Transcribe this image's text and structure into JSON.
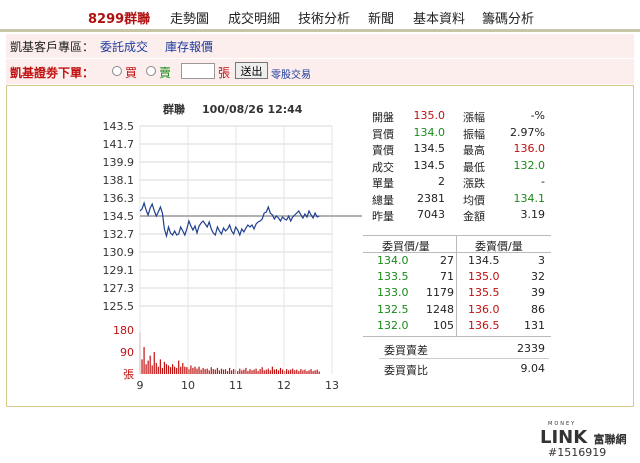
{
  "nav": {
    "items": [
      "8299群聯",
      "走勢圖",
      "成交明細",
      "技術分析",
      "新聞",
      "基本資料",
      "籌碼分析"
    ]
  },
  "broker": {
    "label": "凱基客戶專區：",
    "link1": "委託成交",
    "link2": "庫存報價"
  },
  "order": {
    "title": "凱基證劵下單：",
    "buy": "買",
    "sell": "賣",
    "qty_value": "",
    "unit": "張",
    "send": "送出",
    "oddlot": "零股交易"
  },
  "chart_data": {
    "type": "line",
    "title": "群聯",
    "datetime": "100/08/26 12:44",
    "reference_price": 134.5,
    "y_ticks": [
      "143.5",
      "141.7",
      "139.9",
      "138.1",
      "136.3",
      "134.5",
      "132.7",
      "130.9",
      "129.1",
      "127.3",
      "125.5"
    ],
    "ylim": [
      125.5,
      143.5
    ],
    "x_ticks": [
      "9",
      "10",
      "11",
      "12",
      "13"
    ],
    "volume_ticks": [
      "180",
      "90",
      "張"
    ],
    "series": [
      {
        "values": [
          135.0,
          135.2,
          135.8,
          135.1,
          134.6,
          135.3,
          135.7,
          135.0,
          134.5,
          134.9,
          135.4,
          134.8,
          133.2,
          132.5,
          133.4,
          132.8,
          132.6,
          133.0,
          132.6,
          132.7,
          133.4,
          133.0,
          132.6,
          133.2,
          134.0,
          133.5,
          133.1,
          133.5,
          132.8,
          133.5,
          133.8,
          134.0,
          133.7,
          133.4,
          133.9,
          133.2,
          132.8,
          132.6,
          133.4,
          133.0,
          132.7,
          133.3,
          133.0,
          133.2,
          133.6,
          133.0,
          132.7,
          133.4,
          133.1,
          132.6,
          133.2,
          132.9,
          133.3,
          133.6,
          133.4,
          133.6,
          133.2,
          133.7,
          133.9,
          134.0,
          134.2,
          134.8,
          134.9,
          135.4,
          134.8,
          134.6,
          134.2,
          134.5,
          134.3,
          134.0,
          134.4,
          134.2,
          134.1,
          134.5,
          134.0,
          134.4,
          134.6,
          134.8,
          135.0,
          134.6,
          134.3,
          134.7,
          134.4,
          135.0,
          134.6,
          134.3,
          134.8,
          134.4,
          134.5
        ]
      }
    ],
    "volume": [
      170,
      60,
      110,
      40,
      55,
      75,
      35,
      90,
      45,
      30,
      60,
      25,
      50,
      40,
      35,
      28,
      40,
      30,
      25,
      55,
      30,
      45,
      30,
      28,
      20,
      35,
      25,
      30,
      22,
      30,
      18,
      25,
      20,
      22,
      15,
      28,
      20,
      18,
      25,
      15,
      22,
      18,
      20,
      12,
      25,
      15,
      20,
      18,
      12,
      22,
      15,
      18,
      25,
      12,
      20,
      15,
      18,
      22,
      12,
      20,
      28,
      15,
      18,
      22,
      15,
      30,
      18,
      20,
      15,
      25,
      18,
      12,
      20,
      15,
      18,
      22,
      15,
      18,
      12,
      20,
      15,
      18,
      12,
      15,
      20,
      12,
      15,
      18,
      10
    ],
    "volume_max": 180
  },
  "quote": {
    "rows": [
      {
        "l1": "開盤",
        "v1": "135.0",
        "c1": "rd",
        "l2": "漲幅",
        "v2": "-%",
        "c2": "bk"
      },
      {
        "l1": "買價",
        "v1": "134.0",
        "c1": "gr",
        "l2": "振幅",
        "v2": "2.97%",
        "c2": "bk"
      },
      {
        "l1": "賣價",
        "v1": "134.5",
        "c1": "bk",
        "l2": "最高",
        "v2": "136.0",
        "c2": "rd"
      },
      {
        "l1": "成交",
        "v1": "134.5",
        "c1": "bk",
        "l2": "最低",
        "v2": "132.0",
        "c2": "gr"
      },
      {
        "l1": "單量",
        "v1": "2",
        "c1": "bk",
        "l2": "漲跌",
        "v2": "-",
        "c2": "bk"
      },
      {
        "l1": "總量",
        "v1": "2381",
        "c1": "bk",
        "l2": "均價",
        "v2": "134.1",
        "c2": "gr"
      },
      {
        "l1": "昨量",
        "v1": "7043",
        "c1": "bk",
        "l2": "金額",
        "v2": "3.19",
        "c2": "bk"
      }
    ],
    "bid_header": "委買價/量",
    "ask_header": "委賣價/量",
    "book": [
      {
        "bp": "134.0",
        "bv": "27",
        "ap": "134.5",
        "av": "3",
        "apc": "bk"
      },
      {
        "bp": "133.5",
        "bv": "71",
        "ap": "135.0",
        "av": "32",
        "apc": "rd"
      },
      {
        "bp": "133.0",
        "bv": "1179",
        "ap": "135.5",
        "av": "39",
        "apc": "rd"
      },
      {
        "bp": "132.5",
        "bv": "1248",
        "ap": "136.0",
        "av": "86",
        "apc": "rd"
      },
      {
        "bp": "132.0",
        "bv": "105",
        "ap": "136.5",
        "av": "131",
        "apc": "rd"
      }
    ],
    "diff_label": "委買賣差",
    "diff_value": "2339",
    "ratio_label": "委買賣比",
    "ratio_value": "9.04"
  },
  "footer": {
    "logo_money": "MONEY",
    "logo_link": "LINK",
    "logo_cn": "富聯網",
    "code": "#1516919"
  }
}
